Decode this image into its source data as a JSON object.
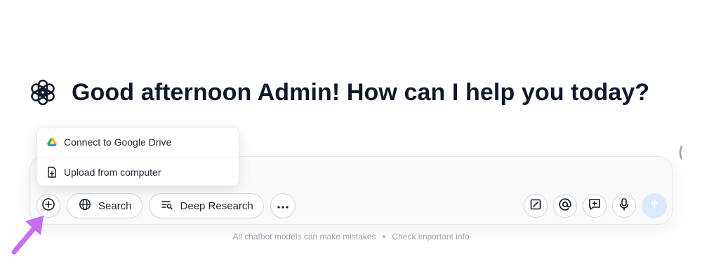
{
  "greeting": {
    "text": "Good afternoon Admin! How can I help you today?",
    "logo_icon": "openai-logo-icon"
  },
  "attach_menu": {
    "items": [
      {
        "label": "Connect to Google Drive",
        "icon": "google-drive-icon"
      },
      {
        "label": "Upload from computer",
        "icon": "file-upload-icon"
      }
    ]
  },
  "toolbar": {
    "attach_icon": "plus-circle-icon",
    "search_label": "Search",
    "search_icon": "globe-icon",
    "deep_research_label": "Deep Research",
    "deep_research_icon": "list-search-icon",
    "more_icon": "more-dots-icon",
    "right_icons": [
      "edit-square-icon",
      "at-sign-icon",
      "add-message-icon",
      "microphone-icon",
      "send-arrow-icon"
    ]
  },
  "disclaimer": {
    "left": "All chatbot models can make mistakes",
    "separator": "•",
    "right": "Check important info"
  },
  "colors": {
    "accent_arrow": "#c86cf0",
    "send_disabled": "#dbeafe",
    "text_primary": "#0f172a"
  }
}
